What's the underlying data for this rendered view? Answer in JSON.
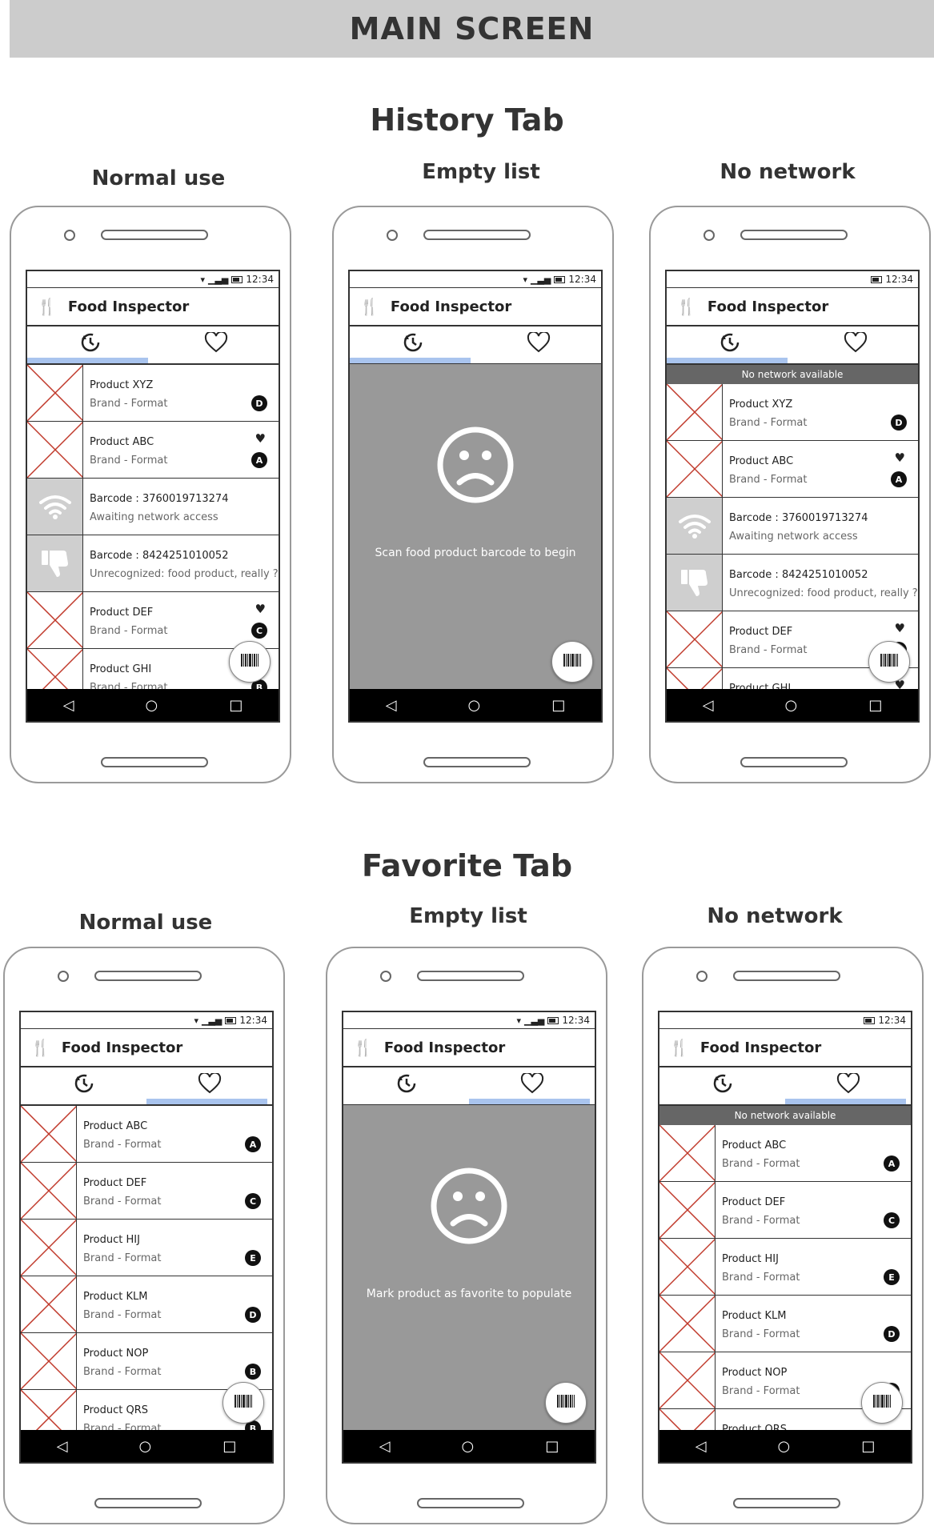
{
  "banner": "MAIN SCREEN",
  "history_title": "History Tab",
  "favorite_title": "Favorite Tab",
  "labels": {
    "normal": "Normal use",
    "empty": "Empty list",
    "nonet": "No network"
  },
  "phone": {
    "time": "12:34",
    "app_title": "Food Inspector",
    "no_network": "No network available"
  },
  "empty_history": "Scan food product barcode to begin",
  "empty_favorite": "Mark product as favorite to populate",
  "history_rows": [
    {
      "title": "Product XYZ",
      "sub": "Brand - Format",
      "badge": "D",
      "fav": false,
      "kind": "x"
    },
    {
      "title": "Product ABC",
      "sub": "Brand - Format",
      "badge": "A",
      "fav": true,
      "kind": "x"
    },
    {
      "title": "Barcode : 3760019713274",
      "sub": "Awaiting network access",
      "badge": "",
      "fav": false,
      "kind": "wifi"
    },
    {
      "title": "Barcode : 8424251010052",
      "sub": "Unrecognized: food product, really ?",
      "badge": "",
      "fav": false,
      "kind": "thumb"
    },
    {
      "title": "Product DEF",
      "sub": "Brand - Format",
      "badge": "C",
      "fav": true,
      "kind": "x"
    },
    {
      "title": "Product GHI",
      "sub": "Brand - Format",
      "badge": "B",
      "fav": true,
      "kind": "x"
    }
  ],
  "favorite_rows": [
    {
      "title": "Product ABC",
      "sub": "Brand - Format",
      "badge": "A",
      "fav": false,
      "kind": "x"
    },
    {
      "title": "Product DEF",
      "sub": "Brand - Format",
      "badge": "C",
      "fav": false,
      "kind": "x"
    },
    {
      "title": "Product HIJ",
      "sub": "Brand - Format",
      "badge": "E",
      "fav": false,
      "kind": "x"
    },
    {
      "title": "Product KLM",
      "sub": "Brand - Format",
      "badge": "D",
      "fav": false,
      "kind": "x"
    },
    {
      "title": "Product NOP",
      "sub": "Brand - Format",
      "badge": "B",
      "fav": false,
      "kind": "x"
    },
    {
      "title": "Product QRS",
      "sub": "Brand - Format",
      "badge": "B",
      "fav": false,
      "kind": "x"
    }
  ],
  "icons": {
    "history_tab": "history-icon",
    "favorite_tab": "heart-icon",
    "app": "fork-knife-icon",
    "scan": "barcode-icon",
    "nav": [
      "back-icon",
      "home-icon",
      "recents-icon"
    ]
  }
}
